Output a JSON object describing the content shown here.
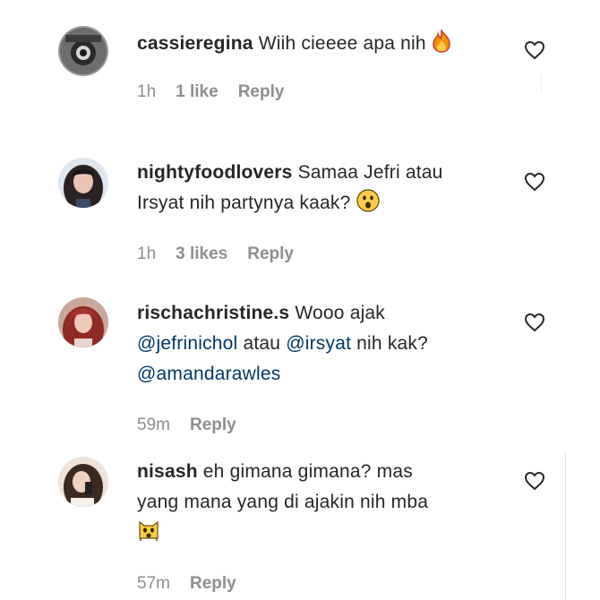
{
  "comments": [
    {
      "username": "cassieregina",
      "text": "Wiih cieeee apa nih",
      "emoji": "fire-emoji",
      "time": "1h",
      "likes": "1 like",
      "reply": "Reply"
    },
    {
      "username": "nightyfoodlovers",
      "text": "Samaa Jefri atau",
      "text2": "Irsyat nih partynya kaak?",
      "emoji": "astonished-face-emoji",
      "time": "1h",
      "likes": "3 likes",
      "reply": "Reply"
    },
    {
      "username": "rischachristine.s",
      "text": "Wooo ajak",
      "mention1": "@jefrinichol",
      "text_mid": "atau",
      "mention2": "@irsyat",
      "text_end": "nih kak?",
      "mention3": "@amandarawles",
      "time": "59m",
      "reply": "Reply"
    },
    {
      "username": "nisash",
      "text": "eh gimana gimana? mas",
      "text2": "yang mana yang di ajakin nih mba",
      "emoji": "screaming-cat-emoji",
      "time": "57m",
      "reply": "Reply"
    }
  ]
}
